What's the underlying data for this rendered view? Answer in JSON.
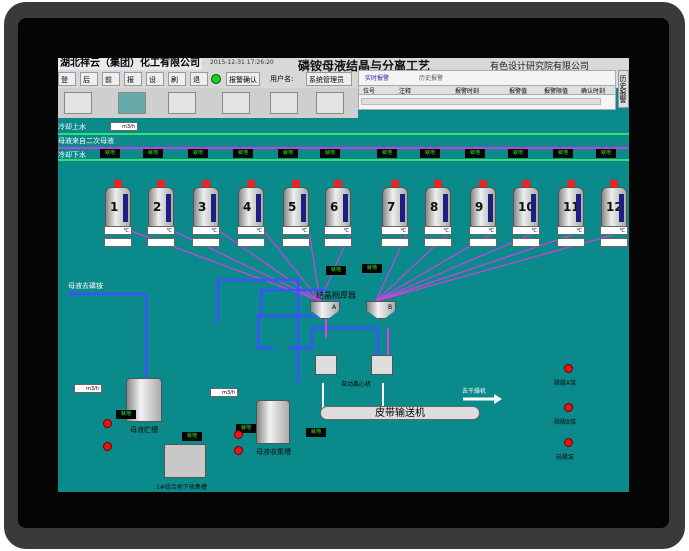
{
  "header": {
    "company": "湖北祥云（集团）化工有限公司",
    "datetime": "2015-12-31 17:26:20",
    "title": "磷铵母液结晶与分离工艺",
    "institute": "有色设计研究院有限公司"
  },
  "toolbar": {
    "buttons": [
      "登录",
      "后退",
      "前进",
      "报表",
      "设置",
      "刷新",
      "退出"
    ],
    "alarm_confirm": "报警确认",
    "user_label": "用户名:",
    "user": "系统管理员"
  },
  "alarm_panel": {
    "tabs": [
      "实时报警",
      "历史报警"
    ],
    "columns": [
      "位号",
      "注释",
      "报警时刻",
      "报警值",
      "报警限值",
      "确认时刻"
    ],
    "history_button": "历史报警"
  },
  "lines": {
    "cooling_in": "冷却上水",
    "cooling_in_unit": "m3/h",
    "mother_liquor_in": "母液来自二次母液",
    "cooling_out": "冷却下水",
    "mother_out": "母液去磷铵"
  },
  "status": "就地",
  "unit_c": "℃",
  "crystallizers": [
    "1",
    "2",
    "3",
    "4",
    "5",
    "6",
    "7",
    "8",
    "9",
    "10",
    "11",
    "12"
  ],
  "equipment": {
    "thickener": "结晶稠厚器",
    "thickener_a": "A",
    "thickener_b": "B",
    "centrifuge": "自动离心机",
    "to_dryer": "去干燥机",
    "conveyor": "皮带输送机",
    "storage_tank": "母液贮槽",
    "collect_tank": "母液收集槽",
    "underground_tank": "1#综合地下收集槽",
    "flow_unit": "m3/h",
    "pump_a": "磷酸A泵",
    "pump_b": "磷酸B泵",
    "pump_c": "硅酸泵"
  },
  "colors": {
    "background": "#0a8a8a",
    "pipe_purple": "#c040e0",
    "pipe_green": "#30e070",
    "pipe_blue": "#4050ff"
  }
}
